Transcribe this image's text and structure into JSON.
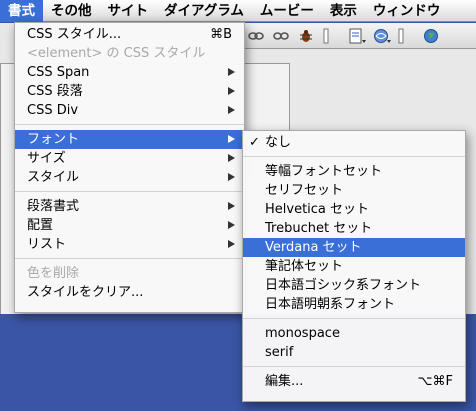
{
  "menubar": {
    "items": [
      "書式",
      "その他",
      "サイト",
      "ダイアグラム",
      "ムービー",
      "表示",
      "ウィンドウ"
    ],
    "active_index": 0
  },
  "format_menu": {
    "css_style": "CSS スタイル...",
    "css_style_shortcut": "⌘B",
    "element_css_style": "<element> の CSS スタイル",
    "css_span": "CSS Span",
    "css_paragraph": "CSS 段落",
    "css_div": "CSS Div",
    "font": "フォント",
    "size": "サイズ",
    "style": "スタイル",
    "paragraph_format": "段落書式",
    "alignment": "配置",
    "list": "リスト",
    "remove_color": "色を削除",
    "clear_style": "スタイルをクリア..."
  },
  "font_submenu": {
    "none": "なし",
    "checkmark": "✓",
    "items_group1": [
      "等幅フォントセット",
      "セリフセット",
      "Helvetica セット",
      "Trebuchet セット",
      "Verdana セット",
      "筆記体セット",
      "日本語ゴシック系フォント",
      "日本語明朝系フォント"
    ],
    "selected_index": 4,
    "items_group2": [
      "monospace",
      "serif"
    ],
    "edit": "編集...",
    "edit_shortcut": "⌥⌘F"
  }
}
